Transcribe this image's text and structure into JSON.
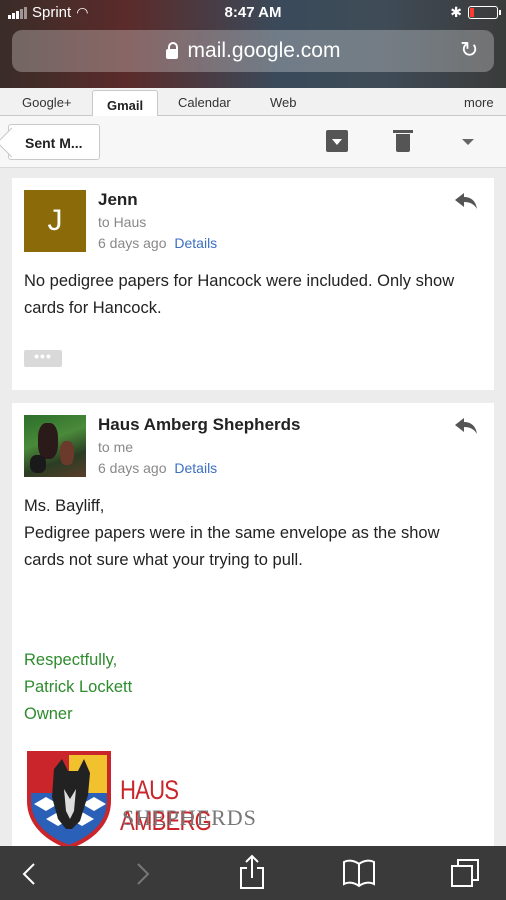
{
  "status": {
    "carrier": "Sprint",
    "time": "8:47 AM"
  },
  "browser": {
    "url": "mail.google.com"
  },
  "tabs": [
    {
      "label": "Google+"
    },
    {
      "label": "Gmail"
    },
    {
      "label": "Calendar"
    },
    {
      "label": "Web"
    },
    {
      "label": "more"
    }
  ],
  "toolbar": {
    "back_label": "Sent M..."
  },
  "messages": [
    {
      "avatar_letter": "J",
      "avatar_color": "#8b6a09",
      "sender": "Jenn",
      "to": "to Haus",
      "time": "6 days ago",
      "details": "Details",
      "body": "No pedigree papers for Hancock were included. Only show cards for Hancock.",
      "more": "•••"
    },
    {
      "sender": "Haus Amberg Shepherds",
      "to": "to me",
      "time": "6 days ago",
      "details": "Details",
      "body_line1": "Ms. Bayliff,",
      "body_line2": "Pedigree papers were in the same envelope as the show cards not sure what your trying to pull.",
      "signature": [
        "Respectfully,",
        "Patrick Lockett",
        "Owner"
      ],
      "logo_line1": "HAUS AMBERG",
      "logo_line2": "SHEPHERDS"
    }
  ],
  "colors": {
    "link": "#3b6fc1",
    "signature": "#2e8b2e",
    "logo_red": "#c9252b"
  }
}
